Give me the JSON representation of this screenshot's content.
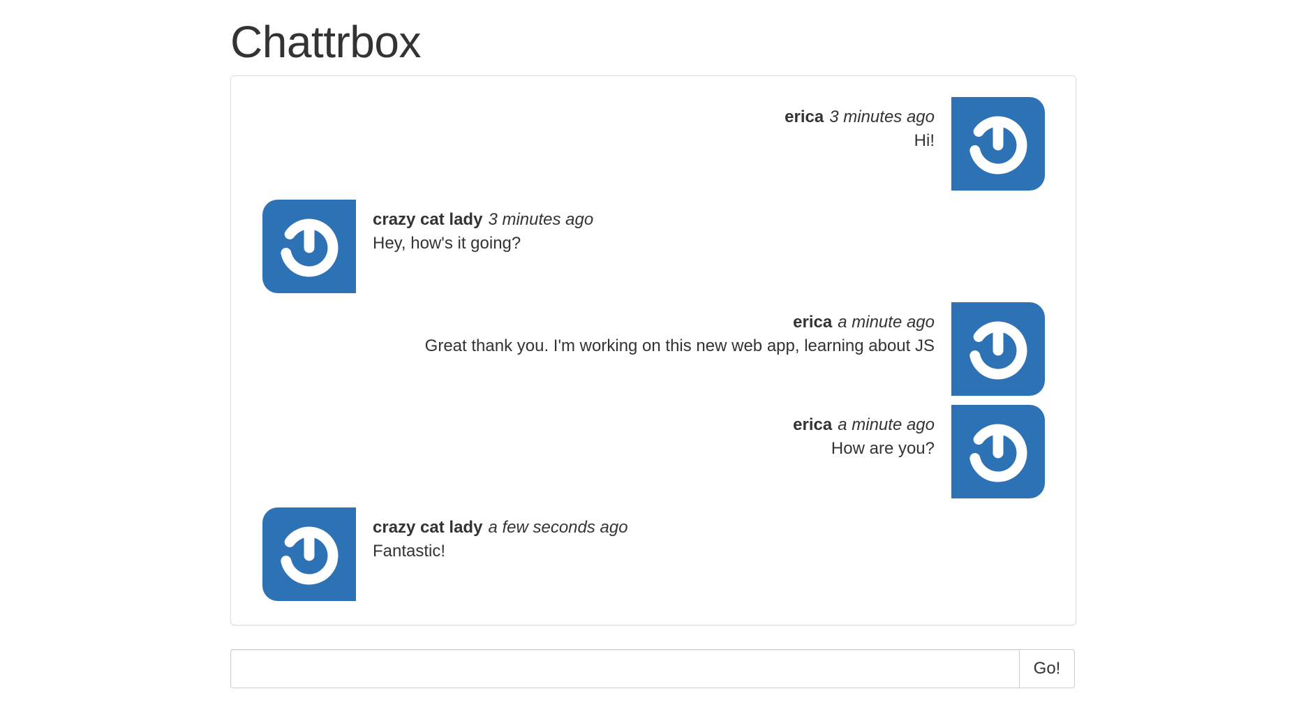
{
  "app": {
    "title": "Chattrbox"
  },
  "colors": {
    "avatar_bg": "#2e72b6",
    "avatar_icon": "#ffffff",
    "text": "#333333",
    "border": "#dddddd"
  },
  "messages": [
    {
      "author": "erica",
      "time": "3 minutes ago",
      "text": "Hi!",
      "side": "right",
      "avatar_icon": "power-logo-icon"
    },
    {
      "author": "crazy cat lady",
      "time": "3 minutes ago",
      "text": "Hey, how's it going?",
      "side": "left",
      "avatar_icon": "power-logo-icon"
    },
    {
      "author": "erica",
      "time": "a minute ago",
      "text": "Great thank you. I'm working on this new web app, learning about JS",
      "side": "right",
      "avatar_icon": "power-logo-icon"
    },
    {
      "author": "erica",
      "time": "a minute ago",
      "text": "How are you?",
      "side": "right",
      "avatar_icon": "power-logo-icon"
    },
    {
      "author": "crazy cat lady",
      "time": "a few seconds ago",
      "text": "Fantastic!",
      "side": "left",
      "avatar_icon": "power-logo-icon"
    }
  ],
  "composer": {
    "value": "",
    "placeholder": "",
    "button_label": "Go!"
  }
}
